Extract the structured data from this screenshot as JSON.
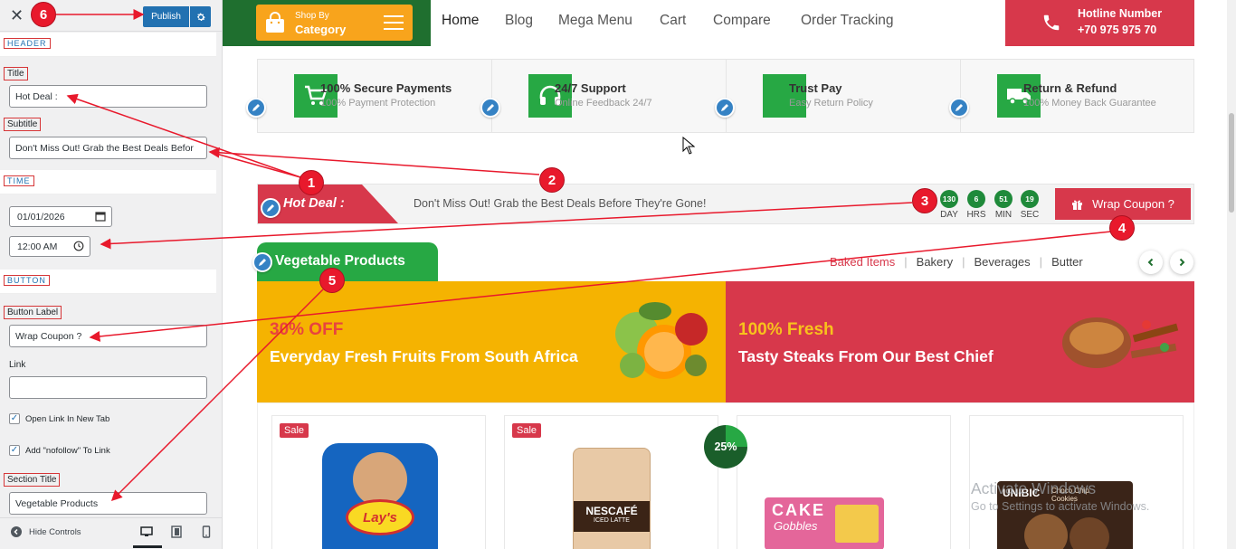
{
  "customizer": {
    "close_glyph": "✕",
    "publish_label": "Publish",
    "sections": {
      "header": "HEADER",
      "time": "TIME",
      "button": "BUTTON"
    },
    "fields": {
      "title_label": "Title",
      "title_value": "Hot Deal :",
      "subtitle_label": "Subtitle",
      "subtitle_value": "Don't Miss Out! Grab the Best Deals Befor",
      "date_value": "01/01/2026",
      "time_value": "12:00 AM",
      "button_label_label": "Button Label",
      "button_label_value": "Wrap Coupon ?",
      "link_label": "Link",
      "link_value": "",
      "open_new_tab_label": "Open Link In New Tab",
      "open_new_tab_checked": true,
      "nofollow_label": "Add \"nofollow\" To Link",
      "nofollow_checked": true,
      "section_title_label": "Section Title",
      "section_title_value": "Vegetable Products"
    },
    "hide_controls_label": "Hide Controls",
    "device_icons": [
      "desktop-icon",
      "tablet-icon",
      "mobile-icon"
    ]
  },
  "site": {
    "shop_by_line1": "Shop By",
    "shop_by_line2": "Category",
    "nav": [
      "Home",
      "Blog",
      "Mega Menu",
      "Cart",
      "Compare",
      "Order Tracking"
    ],
    "nav_active": "Home",
    "hotline_title": "Hotline Number",
    "hotline_number": "+70 975 975 70",
    "features": [
      {
        "title": "100% Secure Payments",
        "subtitle": "100% Payment Protection",
        "icon": "cart-icon"
      },
      {
        "title": "24/7 Support",
        "subtitle": "Online Feedback 24/7",
        "icon": "headphones-icon"
      },
      {
        "title": "Trust Pay",
        "subtitle": "Easy Return Policy",
        "icon": "trust-pay-icon"
      },
      {
        "title": "Return & Refund",
        "subtitle": "100% Money Back Guarantee",
        "icon": "truck-icon"
      }
    ],
    "hot_deal": {
      "title": "Hot Deal :",
      "subtitle": "Don't Miss Out! Grab the Best Deals Before They're Gone!",
      "countdown": [
        {
          "value": "130",
          "unit": "DAY"
        },
        {
          "value": "6",
          "unit": "HRS"
        },
        {
          "value": "51",
          "unit": "MIN"
        },
        {
          "value": "19",
          "unit": "SEC"
        }
      ],
      "button_label": "Wrap Coupon ?"
    },
    "section_title": "Vegetable Products",
    "category_tabs": [
      "Baked Items",
      "Bakery",
      "Beverages",
      "Butter"
    ],
    "category_tab_active": "Baked Items",
    "banners": [
      {
        "highlight": "30% OFF",
        "text": "Everyday Fresh Fruits From South Africa"
      },
      {
        "highlight": "100% Fresh",
        "text": "Tasty Steaks From Our Best Chief"
      }
    ],
    "products": [
      {
        "badge": "Sale",
        "brand": "Lay's"
      },
      {
        "badge": "Sale",
        "brand": "NESCAFÉ",
        "brand_sub": "ICED LATTE"
      },
      {
        "badge": "",
        "brand": "CAKE",
        "brand_sub": "Gobbles"
      },
      {
        "badge": "",
        "brand": "UNIBIC",
        "brand_sub": "Choco Chip Cookies"
      }
    ],
    "discount_badge": "25%"
  },
  "os_watermark": {
    "line1": "Activate Windows",
    "line2": "Go to Settings to activate Windows."
  },
  "annotations": {
    "markers": [
      "1",
      "2",
      "3",
      "4",
      "5",
      "6"
    ]
  },
  "colors": {
    "accent_red": "#d7384b",
    "accent_green": "#27a844",
    "accent_orange": "#f8a41c",
    "wp_blue": "#2271b1",
    "annotation_red": "#e8192c"
  }
}
